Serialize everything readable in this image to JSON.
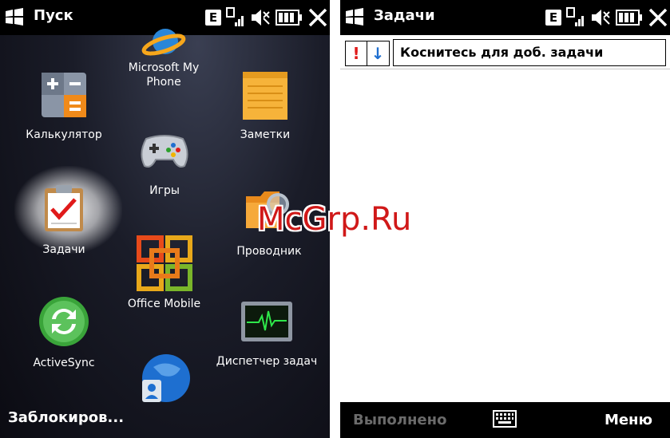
{
  "left_screen": {
    "title": "Пуск",
    "status": {
      "network": "E"
    },
    "tiles": {
      "microsoft_my_phone_1": "Microsoft My",
      "microsoft_my_phone_2": "Phone",
      "calculator": "Калькулятор",
      "notes": "Заметки",
      "games": "Игры",
      "tasks": "Задачи",
      "explorer": "Проводник",
      "office_mobile": "Office Mobile",
      "activesync": "ActiveSync",
      "task_manager": "Диспетчер задач"
    },
    "softkey_left": "Заблокиров..."
  },
  "right_screen": {
    "title": "Задачи",
    "status": {
      "network": "E"
    },
    "priority_high": "!",
    "priority_low": "↓",
    "new_task_placeholder": "Коснитесь для доб. задачи",
    "softkey_left": "Выполнено",
    "softkey_right": "Меню"
  },
  "watermark": "McGrp.Ru",
  "colors": {
    "accent": "#1e6fd0",
    "priority_high": "#e01a1a",
    "title_bar": "#000000"
  }
}
